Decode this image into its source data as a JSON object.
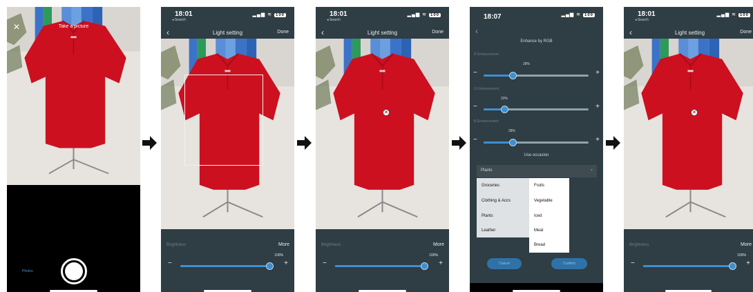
{
  "shot1": {
    "header_title": "Take a picture",
    "photos_label": "Photos"
  },
  "shot2": {
    "status_time": "18:01",
    "status_back": "◂ Search",
    "battery": "100",
    "title": "Light setting",
    "done": "Done",
    "brightness_label": "Brightness",
    "more": "More",
    "percent": "100%",
    "level": 1.0
  },
  "shot3": {
    "status_time": "18:01",
    "status_back": "◂ Search",
    "battery": "100",
    "title": "Light setting",
    "done": "Done",
    "brightness_label": "Brightness",
    "more": "More",
    "percent": "100%",
    "level": 1.0
  },
  "shot4": {
    "status_time": "18:07",
    "battery": "100",
    "title": "Enhance by RGB",
    "sliders": [
      {
        "label": "R Enhancement",
        "percent": "28%",
        "level": 0.28
      },
      {
        "label": "G Enhancement",
        "percent": "20%",
        "level": 0.2
      },
      {
        "label": "B Enhancement",
        "percent": "28%",
        "level": 0.28
      }
    ],
    "occasion_title": "Use occasion",
    "dropdown_value": "Plants",
    "categories": [
      "Groceries",
      "Clothing & Accs",
      "Plants",
      "Leather"
    ],
    "subcategories": [
      "Fruits",
      "Vegetable",
      "Iced",
      "Meat",
      "Bread"
    ],
    "cancel": "Cancel",
    "confirm": "Confirm"
  },
  "shot5": {
    "status_time": "18:01",
    "status_back": "◂ Search",
    "battery": "100",
    "title": "Light setting",
    "done": "Done",
    "brightness_label": "Brightness",
    "more": "More",
    "percent": "100%",
    "level": 1.0
  },
  "colors": {
    "panel": "#2f3d44",
    "accent": "#3f8fd0",
    "shirt": "#cc1020"
  }
}
